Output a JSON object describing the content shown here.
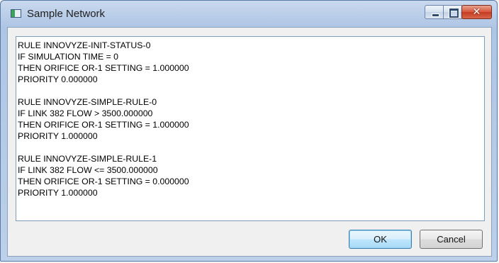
{
  "window": {
    "title": "Sample Network",
    "minimize_label": "",
    "maximize_label": "",
    "close_label": "✕"
  },
  "editor": {
    "text": "RULE INNOVYZE-INIT-STATUS-0\nIF SIMULATION TIME = 0\nTHEN ORIFICE OR-1 SETTING = 1.000000\nPRIORITY 0.000000\n\nRULE INNOVYZE-SIMPLE-RULE-0\nIF LINK 382 FLOW > 3500.000000\nTHEN ORIFICE OR-1 SETTING = 1.000000\nPRIORITY 1.000000\n\nRULE INNOVYZE-SIMPLE-RULE-1\nIF LINK 382 FLOW <= 3500.000000\nTHEN ORIFICE OR-1 SETTING = 0.000000\nPRIORITY 1.000000"
  },
  "buttons": {
    "ok_label": "OK",
    "cancel_label": "Cancel"
  },
  "colors": {
    "titlebar": "#b9cde8",
    "close_button": "#c43c22",
    "default_button_border": "#3c7fb1"
  },
  "icons": {
    "app": "network-window-icon",
    "minimize": "minimize-icon",
    "maximize": "maximize-icon",
    "close": "close-icon"
  }
}
